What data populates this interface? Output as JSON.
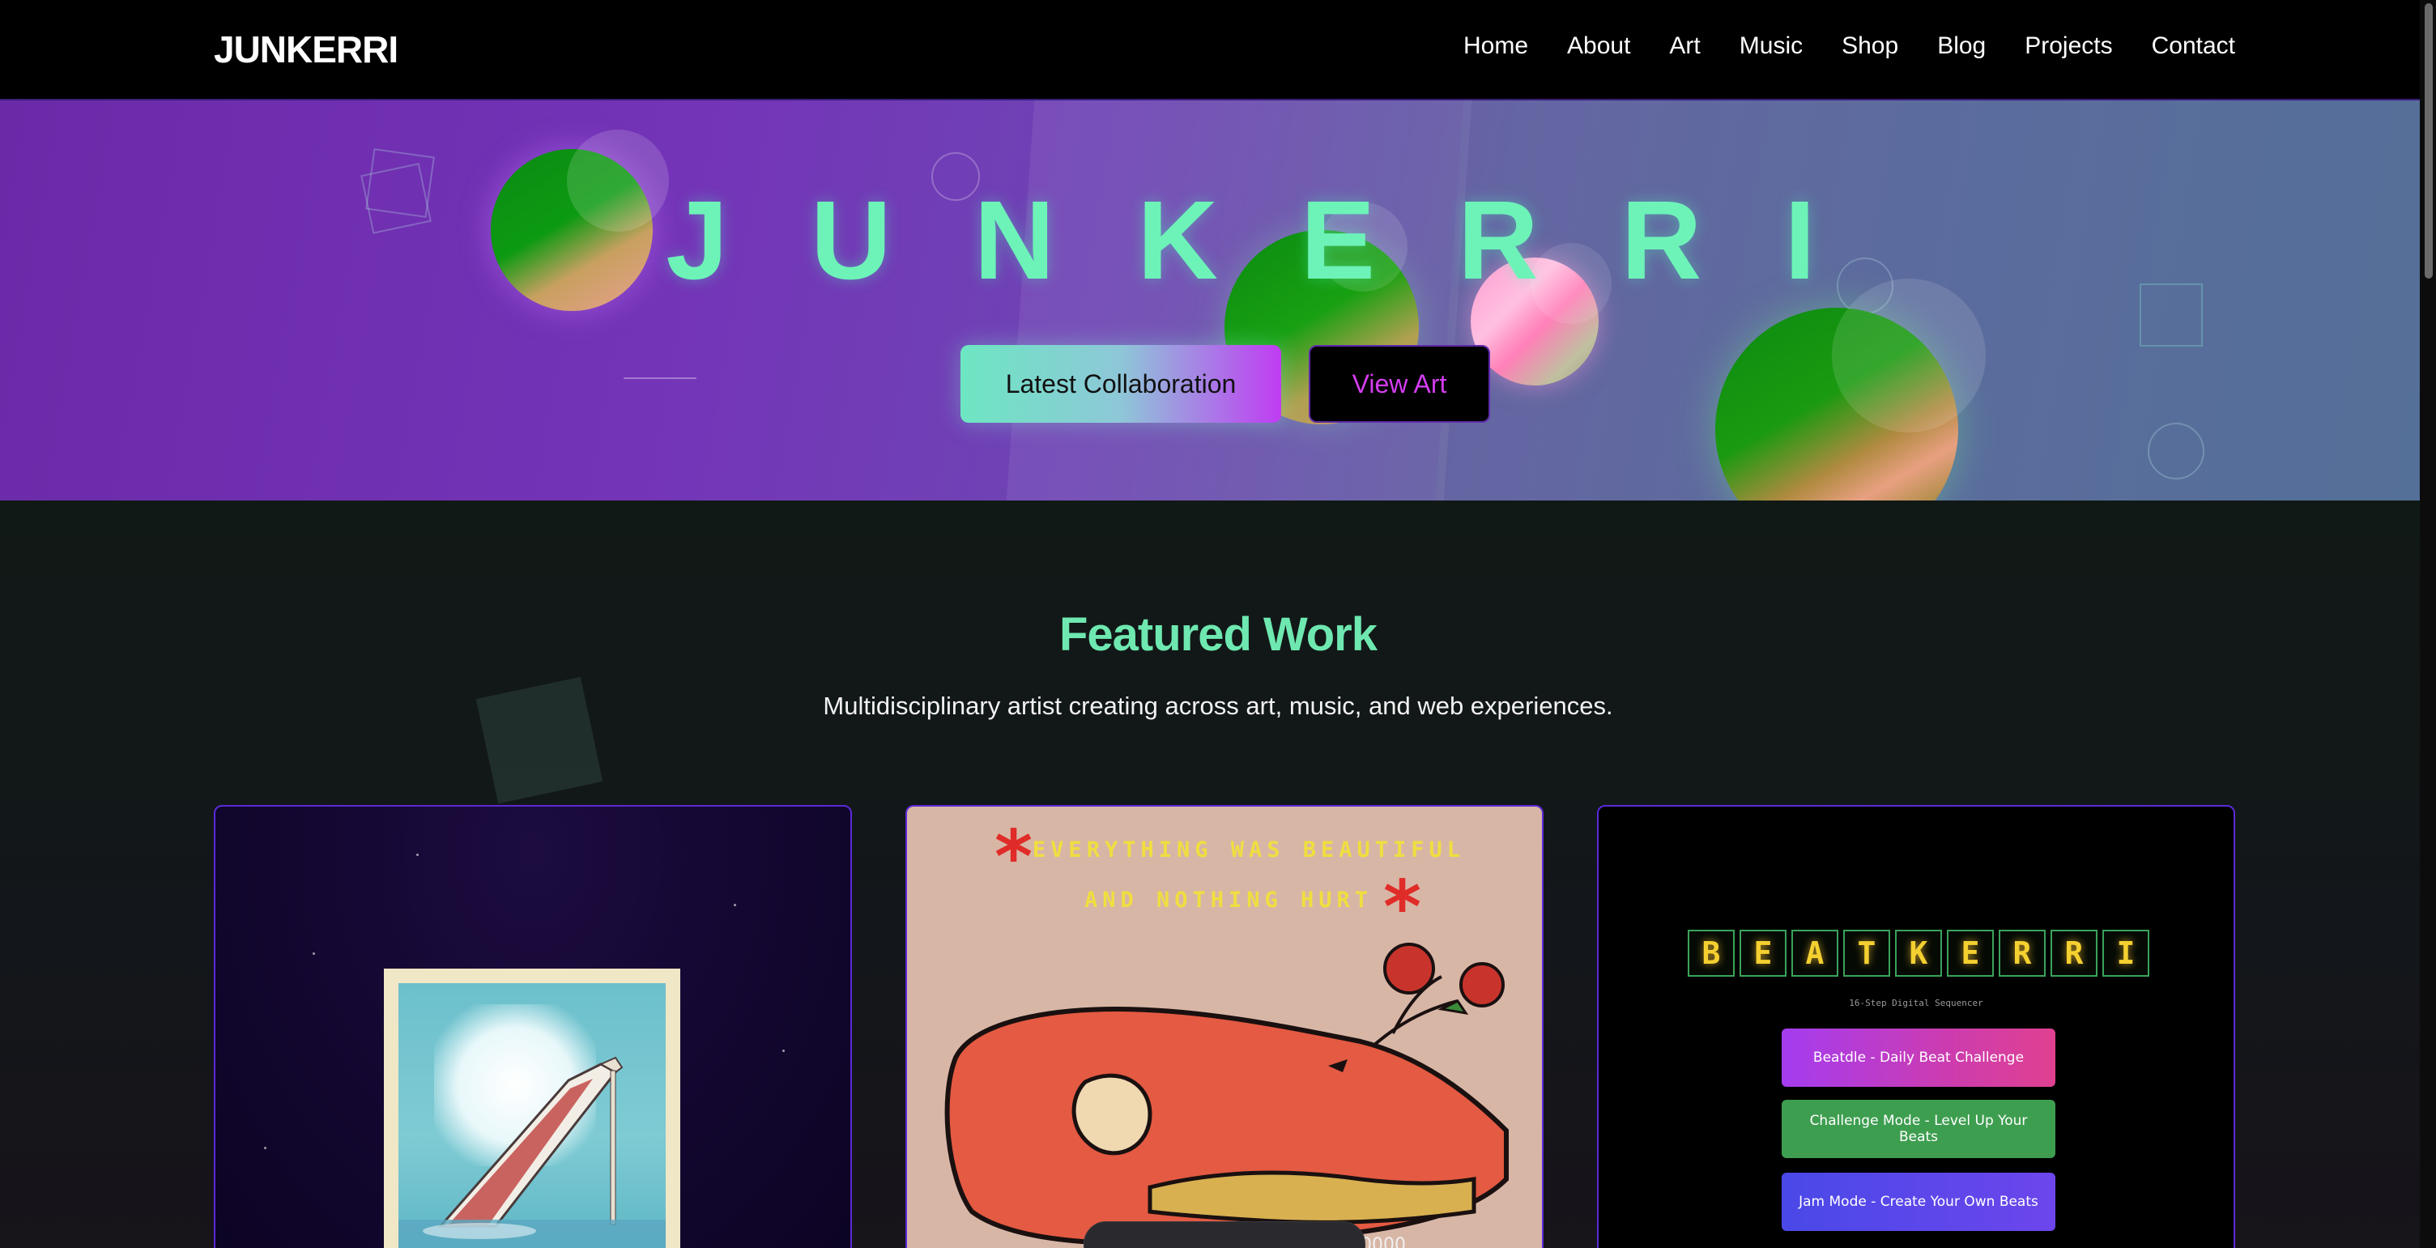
{
  "navbar": {
    "logo": "JUNKERRI",
    "links": [
      "Home",
      "About",
      "Art",
      "Music",
      "Shop",
      "Blog",
      "Projects",
      "Contact"
    ]
  },
  "hero": {
    "title": "JUNKERRI",
    "primary_button": "Latest Collaboration",
    "secondary_button": "View Art"
  },
  "featured": {
    "title": "Featured Work",
    "subtitle": "Multidisciplinary artist creating across art, music, and web experiences.",
    "cards": [
      {
        "id": "art-escalator",
        "kind": "artwork"
      },
      {
        "id": "everything-was-beautiful",
        "kind": "artwork",
        "text_line1": "EVERYTHING WAS BEAUTIFUL",
        "text_line2": "AND NOTHING HURT"
      },
      {
        "id": "beatkerri",
        "kind": "project",
        "logo_letters": [
          "B",
          "E",
          "A",
          "T",
          "K",
          "E",
          "R",
          "R",
          "I"
        ],
        "subtitle": "16-Step Digital Sequencer",
        "buttons": [
          "Beatdle - Daily Beat Challenge",
          "Challenge Mode - Level Up Your Beats",
          "Jam Mode - Create Your Own Beats"
        ]
      }
    ]
  },
  "colors": {
    "accent_mint": "#6df3b8",
    "accent_purple": "#5b2ad6",
    "magenta": "#d43df0",
    "nav_bg": "#000000",
    "page_bg": "#121614"
  },
  "icons": [
    "scrollbar"
  ]
}
